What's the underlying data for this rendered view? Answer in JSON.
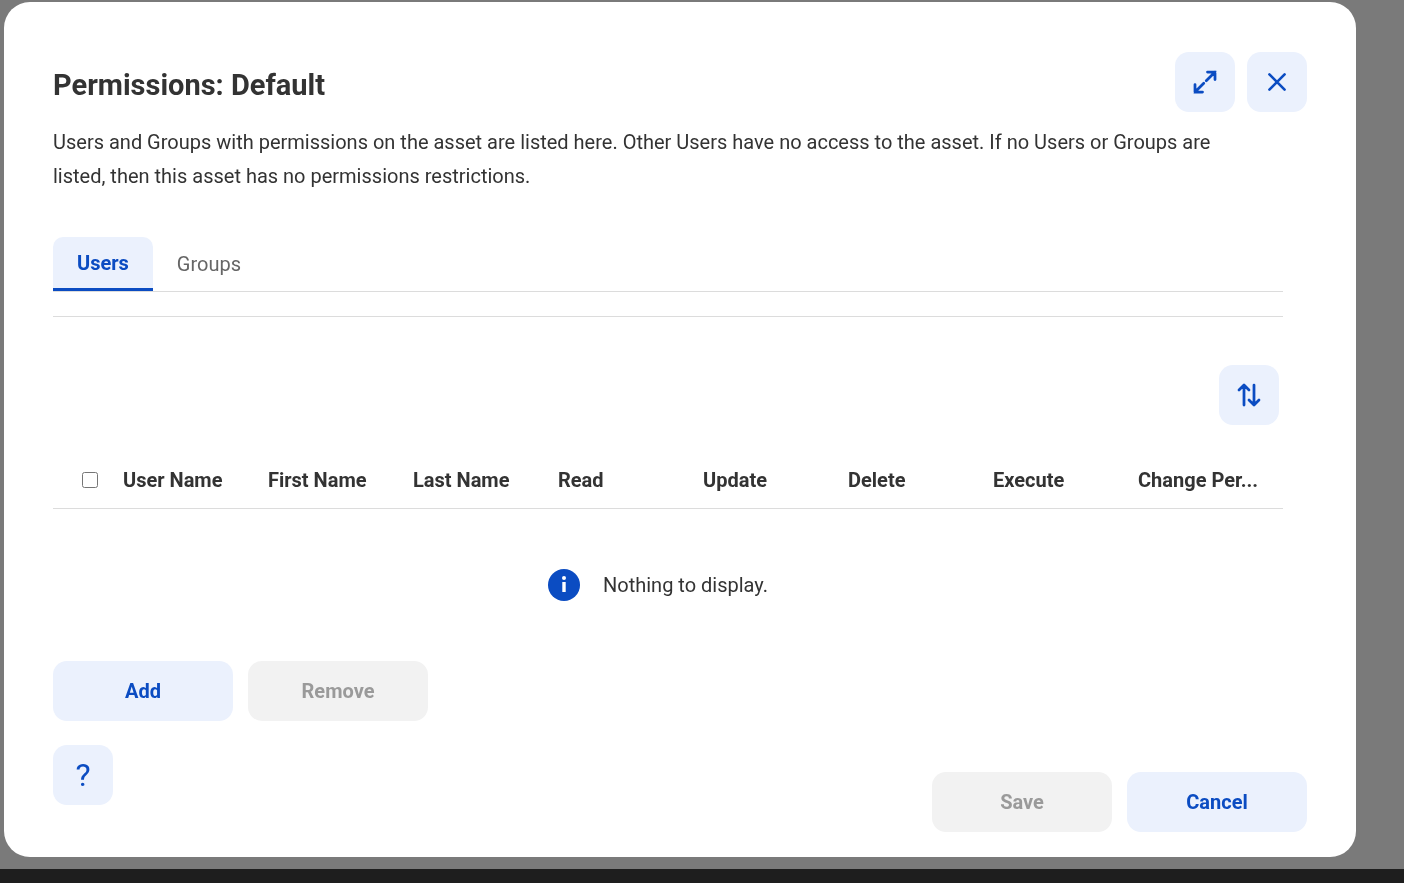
{
  "dialog": {
    "title": "Permissions: Default",
    "description": "Users and Groups with permissions on the asset are listed here. Other Users have no access to the asset. If no Users or Groups are listed, then this asset has no permissions restrictions."
  },
  "tabs": [
    {
      "label": "Users",
      "selected": true
    },
    {
      "label": "Groups",
      "selected": false
    }
  ],
  "table": {
    "select_all_checked": false,
    "columns": [
      "User Name",
      "First Name",
      "Last Name",
      "Read",
      "Update",
      "Delete",
      "Execute",
      "Change Per..."
    ],
    "empty_message": "Nothing to display."
  },
  "table_buttons": [
    {
      "label": "Add",
      "disabled": false
    },
    {
      "label": "Remove",
      "disabled": true
    }
  ],
  "help": {
    "label": "?"
  },
  "footer_buttons": [
    {
      "label": "Save",
      "disabled": true
    },
    {
      "label": "Cancel",
      "disabled": false
    }
  ]
}
